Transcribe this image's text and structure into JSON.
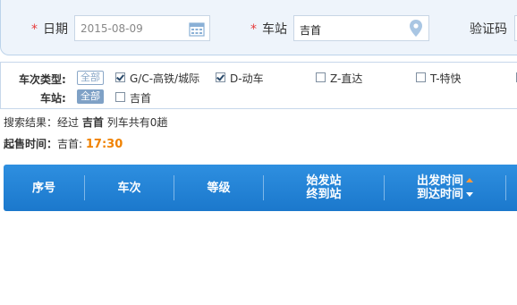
{
  "search": {
    "date_label": "日期",
    "date_value": "2015-08-09",
    "station_label": "车站",
    "station_value": "吉首",
    "captcha_label": "验证码",
    "required_mark": "*"
  },
  "filters": {
    "train_type_label": "车次类型:",
    "station_label": "车站:",
    "all_label": "全部",
    "train_types": [
      {
        "label": "G/C-高铁/城际",
        "checked": true
      },
      {
        "label": "D-动车",
        "checked": true
      },
      {
        "label": "Z-直达",
        "checked": false
      },
      {
        "label": "T-特快",
        "checked": false
      }
    ],
    "stations": [
      {
        "label": "吉首",
        "checked": false
      }
    ]
  },
  "result": {
    "prefix": "搜索结果：经过",
    "station": "吉首",
    "suffix": "列车共有0趟"
  },
  "sale": {
    "label": "起售时间：",
    "station": "吉首:",
    "time": "17:30"
  },
  "table": {
    "headers": {
      "index": "序号",
      "train": "车次",
      "grade": "等级",
      "start_station": "始发站",
      "end_station": "终到站",
      "depart_time": "出发时间",
      "arrive_time": "到达时间"
    }
  },
  "colors": {
    "accent": "#1b78cc",
    "sale_time": "#f08200",
    "required": "#e63a3a"
  }
}
